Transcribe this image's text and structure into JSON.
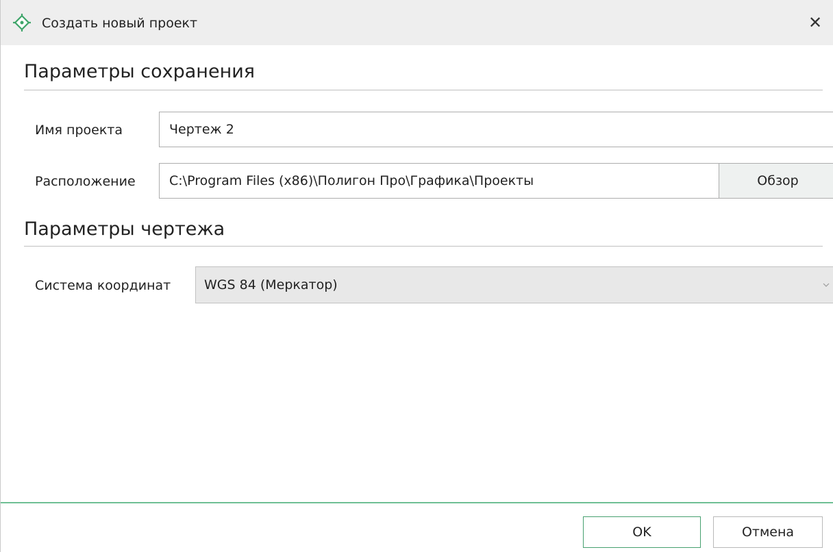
{
  "window": {
    "title": "Создать новый проект",
    "close_glyph": "✕"
  },
  "save_section": {
    "title": "Параметры сохранения",
    "project_name_label": "Имя проекта",
    "project_name_value": "Чертеж 2",
    "location_label": "Расположение",
    "location_value": "C:\\Program Files (x86)\\Полигон Про\\Графика\\Проекты",
    "browse_label": "Обзор"
  },
  "drawing_section": {
    "title": "Параметры чертежа",
    "crs_label": "Система координат",
    "crs_value": "WGS 84 (Меркатор)"
  },
  "footer": {
    "ok_label": "OK",
    "cancel_label": "Отмена"
  },
  "colors": {
    "accent": "#46a06f",
    "titlebar": "#eeeeee"
  },
  "icons": {
    "app": "crosshair-target-icon",
    "close": "close-icon",
    "dropdown": "chevron-down-icon"
  }
}
